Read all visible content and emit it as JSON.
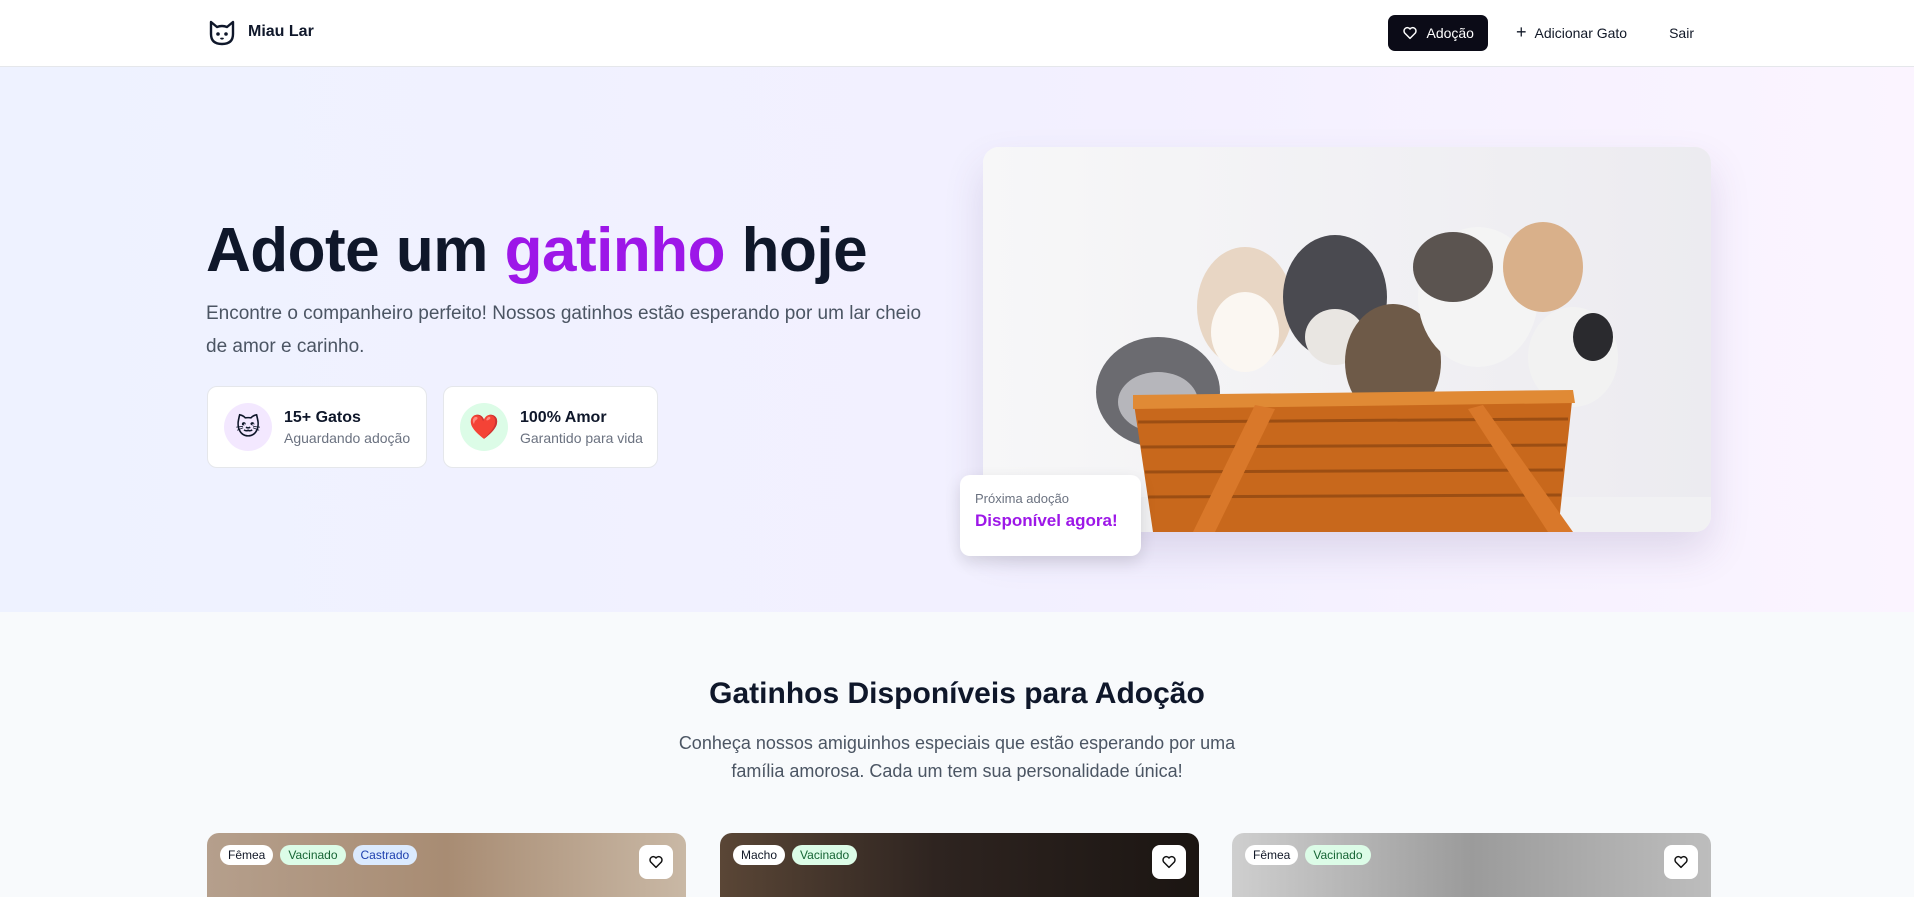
{
  "nav": {
    "brand": "Miau Lar",
    "adopt_label": "Adoção",
    "add_cat_label": "Adicionar Gato",
    "logout_label": "Sair"
  },
  "hero": {
    "title_part1": "Adote um ",
    "title_accent": "gatinho",
    "title_part2": " hoje",
    "subtitle": "Encontre o companheiro perfeito! Nossos gatinhos estão esperando por um lar cheio de amor e carinho.",
    "stats": [
      {
        "title": "15+ Gatos",
        "subtitle": "Aguardando adoção",
        "icon": "cat-emoji"
      },
      {
        "title": "100% Amor",
        "subtitle": "Garantido para vida",
        "icon": "heart-emoji"
      }
    ],
    "next_adoption_label": "Próxima adoção",
    "next_adoption_value": "Disponível agora!"
  },
  "listing": {
    "title": "Gatinhos Disponíveis para Adoção",
    "subtitle": "Conheça nossos amiguinhos especiais que estão esperando por uma família amorosa. Cada um tem sua personalidade única!",
    "cards": [
      {
        "tags": [
          "Fêmea",
          "Vacinado",
          "Castrado"
        ]
      },
      {
        "tags": [
          "Macho",
          "Vacinado"
        ]
      },
      {
        "tags": [
          "Fêmea",
          "Vacinado"
        ]
      }
    ]
  },
  "colors": {
    "accent": "#9d17e8",
    "primary_button": "#0b0b17"
  }
}
